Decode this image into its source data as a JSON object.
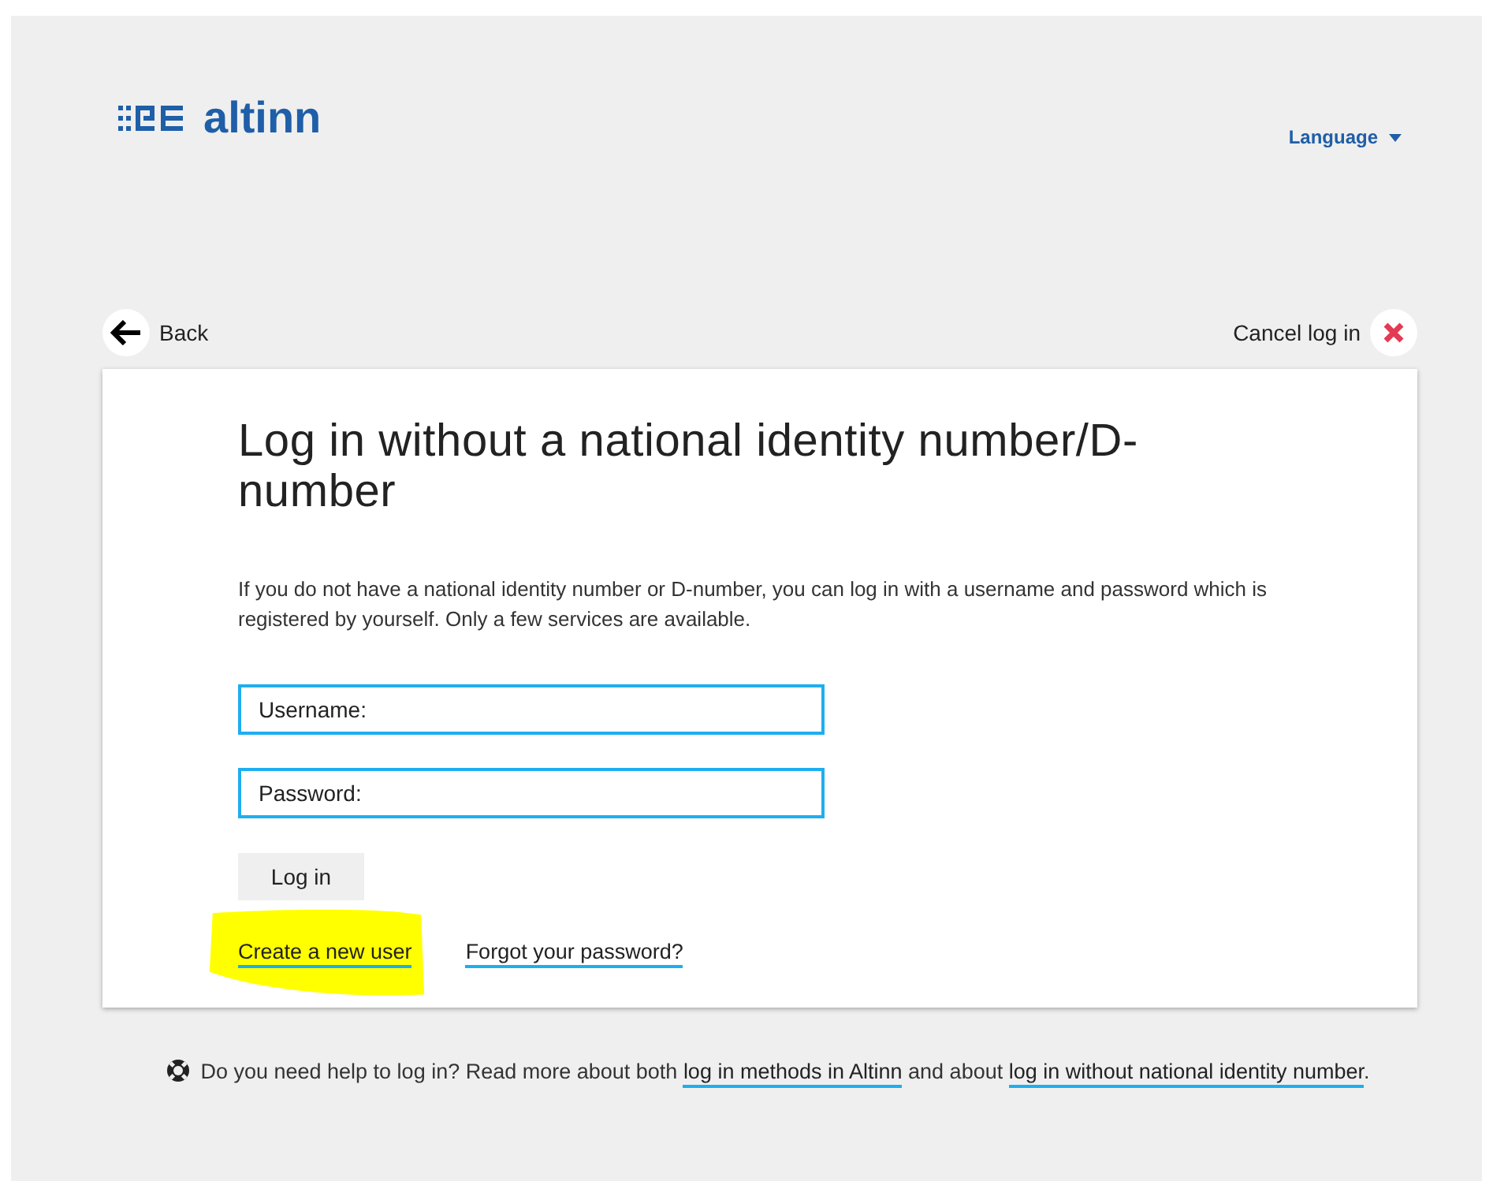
{
  "header": {
    "logo_text": "altinn",
    "language_menu": {
      "label": "Language"
    }
  },
  "nav": {
    "back": "Back",
    "cancel": "Cancel log in"
  },
  "card": {
    "title": "Log in without a national identity number/D-number",
    "intro": "If you do not have a national identity number or D-number, you can log in with a username and password which is registered by yourself. Only a few services are available.",
    "fields": [
      {
        "placeholder": "Username:"
      },
      {
        "placeholder": "Password:"
      }
    ],
    "submit": "Log in",
    "links": [
      {
        "label": "Create a new user",
        "highlighted": true
      },
      {
        "label": "Forgot your password?",
        "highlighted": false
      }
    ]
  },
  "help": {
    "before": "Do you need help to log in? Read more about both ",
    "link_1": "log in methods in Altinn",
    "middle": " and about ",
    "link_2": "log in without national identity number",
    "after": "."
  }
}
